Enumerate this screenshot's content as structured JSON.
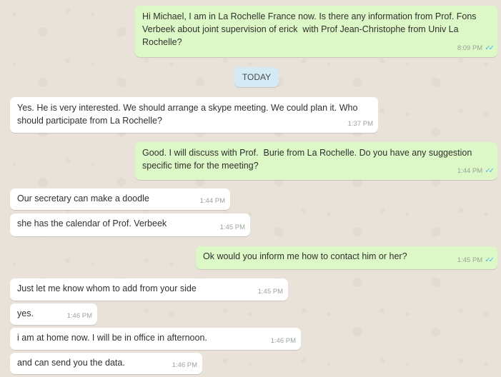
{
  "date_divider": "TODAY",
  "messages": [
    {
      "direction": "outgoing",
      "text": "Hi Michael, I am in La Rochelle France now. Is there any information from Prof. Fons Verbeek about joint supervision of erick  with Prof Jean-Christophe from Univ La Rochelle?",
      "time": "8:09 PM",
      "read": true
    },
    {
      "direction": "incoming",
      "text": "Yes. He is very interested. We should arrange a skype meeting. We could plan it. Who should participate from La Rochelle?",
      "time": "1:37 PM"
    },
    {
      "direction": "outgoing",
      "text": "Good. I will discuss with Prof.  Burie from La Rochelle. Do you have any suggestion specific time for the meeting?",
      "time": "1:44 PM",
      "read": true
    },
    {
      "direction": "incoming",
      "text": "Our secretary can make a doodle",
      "time": "1:44 PM"
    },
    {
      "direction": "incoming",
      "text": "she has the calendar of Prof. Verbeek",
      "time": "1:45 PM"
    },
    {
      "direction": "outgoing",
      "text": "Ok would you inform me how to contact him or her?",
      "time": "1:45 PM",
      "read": true
    },
    {
      "direction": "incoming",
      "text": "Just let me know whom to add from your side",
      "time": "1:45 PM"
    },
    {
      "direction": "incoming",
      "text": "yes.",
      "time": "1:46 PM"
    },
    {
      "direction": "incoming",
      "text": "i am at home now. I will be in office in afternoon.",
      "time": "1:46 PM"
    },
    {
      "direction": "incoming",
      "text": "and can send you the data.",
      "time": "1:46 PM"
    }
  ],
  "colors": {
    "background": "#e9e2d8",
    "incoming_bubble": "#ffffff",
    "outgoing_bubble": "#dcf8c6",
    "date_chip": "#d4eaf4",
    "read_ticks": "#4fb6ec"
  },
  "icons": {
    "read_receipt": "double-check-icon"
  }
}
